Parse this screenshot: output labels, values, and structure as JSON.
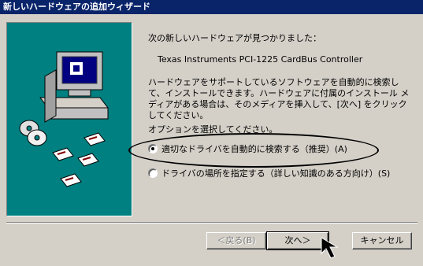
{
  "window": {
    "title": "新しいハードウェアの追加ウィザード"
  },
  "content": {
    "heading": "次の新しいハードウェアが見つかりました：",
    "device_name": "Texas Instruments PCI-1225 CardBus Controller",
    "description": "ハードウェアをサポートしているソフトウェアを自動的に検索して、インストールできます。ハードウェアに付属のインストール メディアがある場合は、そのメディアを挿入して、[次へ] をクリックしてください。",
    "options_prompt": "オプションを選択してください。"
  },
  "options": [
    {
      "label": "適切なドライバを自動的に検索する（推奨）(A)",
      "selected": true
    },
    {
      "label": "ドライバの場所を指定する（詳しい知識のある方向け）(S)",
      "selected": false
    }
  ],
  "buttons": {
    "back": "＜戻る(B)",
    "next": "次へ＞",
    "cancel": "キャンセル"
  },
  "icons": {
    "illustration": "computer-with-discs-icon",
    "cursor": "mouse-pointer-icon"
  },
  "colors": {
    "titlebar": "#0a246a",
    "panel": "#008080",
    "dialog": "#d4d0c8"
  }
}
